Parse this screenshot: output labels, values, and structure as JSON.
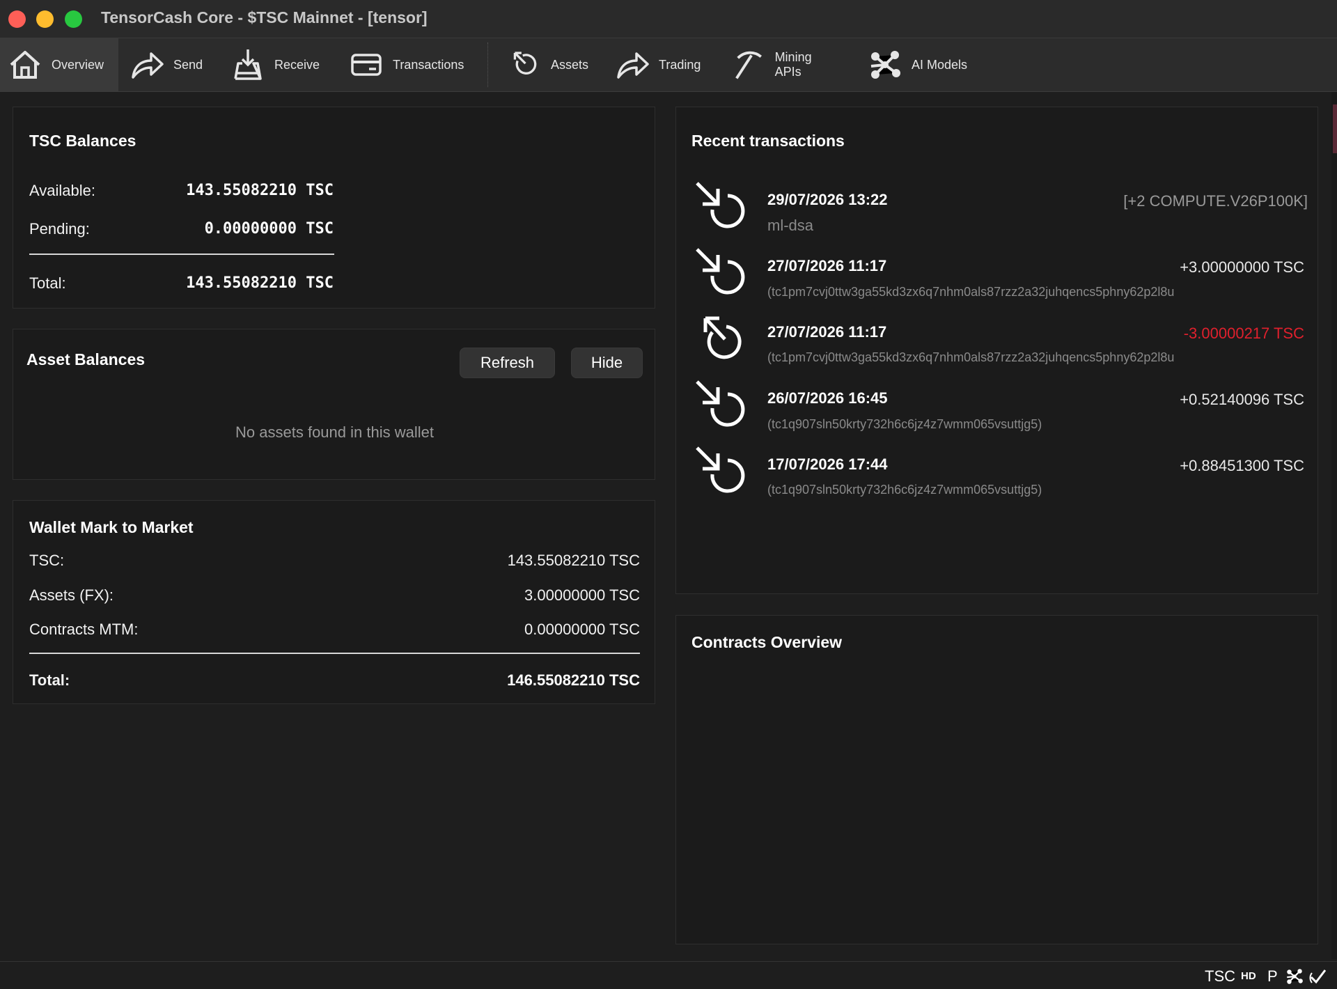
{
  "window": {
    "title": "TensorCash Core - $TSC Mainnet - [tensor]"
  },
  "toolbar": {
    "items": [
      {
        "label": "Overview",
        "icon": "home-icon"
      },
      {
        "label": "Send",
        "icon": "send-arrow-icon"
      },
      {
        "label": "Receive",
        "icon": "receive-tray-icon"
      },
      {
        "label": "Transactions",
        "icon": "card-icon"
      },
      {
        "label": "Assets",
        "icon": "assets-rotate-icon"
      },
      {
        "label": "Trading",
        "icon": "trading-arrow-icon"
      },
      {
        "label": "Mining APIs",
        "icon": "pickaxe-icon"
      },
      {
        "label": "AI Models",
        "icon": "network-icon"
      }
    ]
  },
  "tsc_balances": {
    "title": "TSC Balances",
    "available_label": "Available:",
    "available_value": "143.55082210 TSC",
    "pending_label": "Pending:",
    "pending_value": "0.00000000 TSC",
    "total_label": "Total:",
    "total_value": "143.55082210 TSC"
  },
  "asset_balances": {
    "title": "Asset Balances",
    "refresh_label": "Refresh",
    "hide_label": "Hide",
    "empty_message": "No assets found in this wallet"
  },
  "mark_to_market": {
    "title": "Wallet Mark to Market",
    "tsc_label": "TSC:",
    "tsc_value": "143.55082210 TSC",
    "assets_label": "Assets (FX):",
    "assets_value": "3.00000000 TSC",
    "contracts_label": "Contracts MTM:",
    "contracts_value": "0.00000000 TSC",
    "total_label": "Total:",
    "total_value": "146.55082210 TSC"
  },
  "recent_transactions": {
    "title": "Recent transactions",
    "items": [
      {
        "date": "29/07/2026 13:22",
        "sub": "ml-dsa",
        "amount": "[+2 COMPUTE.V26P100K]",
        "kind": "asset",
        "icon": "receive-arrow-icon"
      },
      {
        "date": "27/07/2026 11:17",
        "sub": "(tc1pm7cvj0ttw3ga55kd3zx6q7nhm0als87rzz2a32juhqencs5phny62p2l8u",
        "amount": "+3.00000000 TSC",
        "kind": "positive",
        "icon": "receive-arrow-icon"
      },
      {
        "date": "27/07/2026 11:17",
        "sub": "(tc1pm7cvj0ttw3ga55kd3zx6q7nhm0als87rzz2a32juhqencs5phny62p2l8u",
        "amount": "-3.00000217 TSC",
        "kind": "negative",
        "icon": "send-rotate-icon"
      },
      {
        "date": "26/07/2026 16:45",
        "sub": "(tc1q907sln50krty732h6c6jz4z7wmm065vsuttjg5)",
        "amount": "+0.52140096 TSC",
        "kind": "positive",
        "icon": "receive-arrow-icon"
      },
      {
        "date": "17/07/2026 17:44",
        "sub": "(tc1q907sln50krty732h6c6jz4z7wmm065vsuttjg5)",
        "amount": "+0.88451300 TSC",
        "kind": "positive",
        "icon": "receive-arrow-icon"
      }
    ]
  },
  "contracts_overview": {
    "title": "Contracts Overview"
  },
  "statusbar": {
    "unit": "TSC",
    "hd": "HD",
    "p": "P"
  },
  "colors": {
    "negative": "#e0202d",
    "background": "#1e1e1e",
    "panel": "#1b1b1b"
  }
}
